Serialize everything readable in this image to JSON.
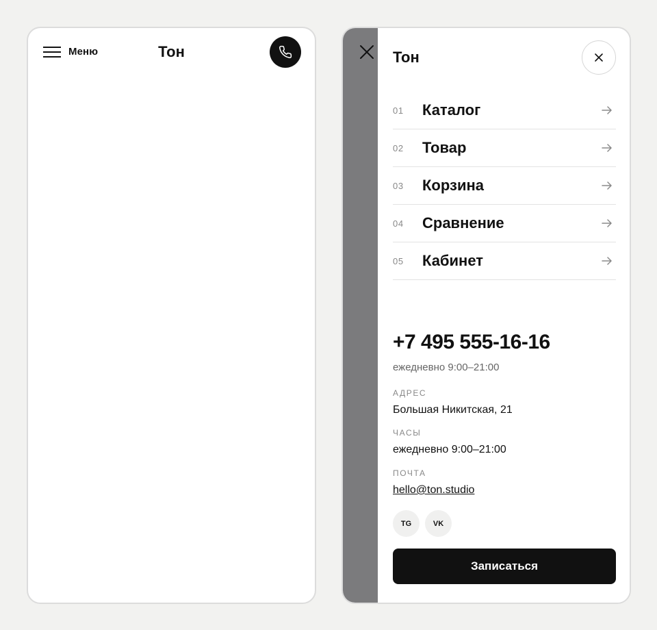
{
  "left_screen": {
    "menu_label": "Меню",
    "logo": "Тон",
    "icons": {
      "menu": "hamburger-icon",
      "call": "phone-icon"
    }
  },
  "drawer": {
    "logo": "Тон",
    "icons": {
      "close": "close-icon",
      "arrow": "arrow-right-icon"
    },
    "nav": [
      {
        "num": "01",
        "label": "Каталог"
      },
      {
        "num": "02",
        "label": "Товар"
      },
      {
        "num": "03",
        "label": "Корзина"
      },
      {
        "num": "04",
        "label": "Сравнение"
      },
      {
        "num": "05",
        "label": "Кабинет"
      }
    ],
    "contacts": {
      "phone": "+7 495 555-16-16",
      "phone_hours": "ежедневно 9:00–21:00",
      "address_label": "АДРЕС",
      "address_value": "Большая Никитская, 21",
      "hours_label": "ЧАСЫ",
      "hours_value": "ежедневно 9:00–21:00",
      "email_label": "ПОЧТА",
      "email_value": "hello@ton.studio"
    },
    "social": [
      "TG",
      "VK"
    ],
    "cta": "Записаться"
  },
  "colors": {
    "background": "#f2f2f0",
    "accent": "#111111",
    "overlay": "#7b7b7d",
    "muted_text": "#888888"
  }
}
